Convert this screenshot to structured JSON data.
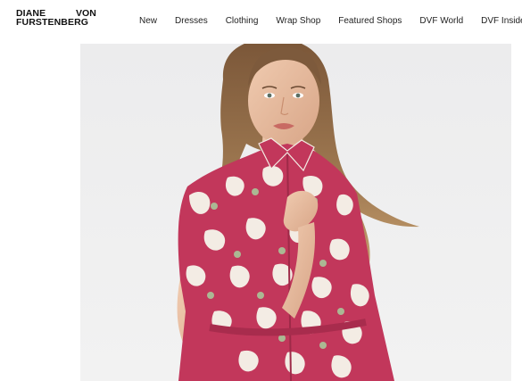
{
  "brand": {
    "line1_left": "DIANE",
    "line1_right": "VON",
    "line2": "FURSTENBERG"
  },
  "nav": {
    "items": [
      {
        "label": "New"
      },
      {
        "label": "Dresses"
      },
      {
        "label": "Clothing"
      },
      {
        "label": "Wrap Shop"
      },
      {
        "label": "Featured Shops"
      },
      {
        "label": "DVF World"
      },
      {
        "label": "DVF Insider"
      }
    ]
  },
  "hero": {
    "image": "model-in-red-floral-shirt-dress-photo",
    "colors": {
      "background": "#efeff0",
      "dress_pink": "#c2375b",
      "dress_cream": "#f3ece4",
      "dress_green": "#a9c79a",
      "hair": "#8a6744",
      "skin": "#e9bfa2"
    }
  },
  "colors": {
    "text": "#111111",
    "nav_text": "#222222",
    "page_background": "#ffffff"
  }
}
